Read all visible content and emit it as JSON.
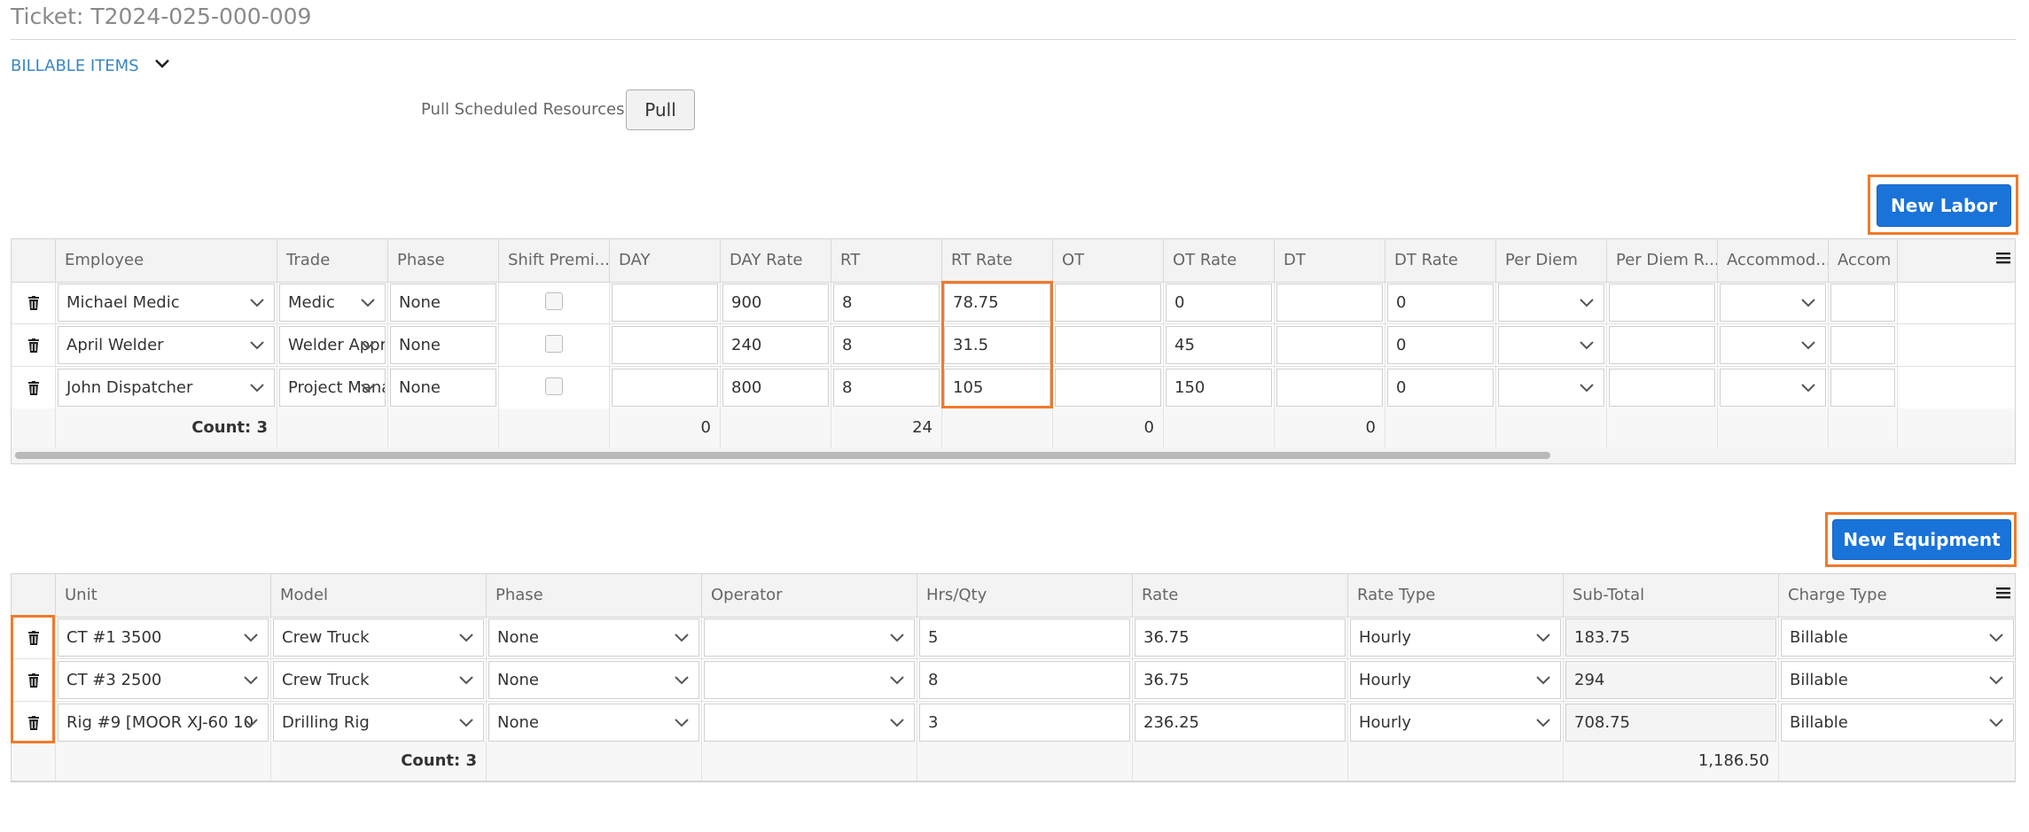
{
  "header": {
    "title": "Ticket: T2024-025-000-009"
  },
  "billable": {
    "section_label": "BILLABLE ITEMS"
  },
  "pull": {
    "label": "Pull Scheduled Resources",
    "button_label": "Pull"
  },
  "labor": {
    "new_button_label": "New Labor",
    "columns": [
      "",
      "Employee",
      "Trade",
      "Phase",
      "Shift Premi...",
      "DAY",
      "DAY Rate",
      "RT",
      "RT Rate",
      "OT",
      "OT Rate",
      "DT",
      "DT Rate",
      "Per Diem",
      "Per Diem R...",
      "Accommod...",
      "Accom"
    ],
    "rows": [
      {
        "employee": "Michael Medic",
        "trade": "Medic",
        "phase": "None",
        "shift_premium": false,
        "day": "",
        "day_rate": "900",
        "rt": "8",
        "rt_rate": "78.75",
        "ot": "",
        "ot_rate": "0",
        "dt": "",
        "dt_rate": "0",
        "per_diem": "",
        "per_diem_rate": "",
        "accommodation": "",
        "accom": ""
      },
      {
        "employee": "April Welder",
        "trade": "Welder Apprentice",
        "phase": "None",
        "shift_premium": false,
        "day": "",
        "day_rate": "240",
        "rt": "8",
        "rt_rate": "31.5",
        "ot": "",
        "ot_rate": "45",
        "dt": "",
        "dt_rate": "0",
        "per_diem": "",
        "per_diem_rate": "",
        "accommodation": "",
        "accom": ""
      },
      {
        "employee": "John Dispatcher",
        "trade": "Project Manager",
        "phase": "None",
        "shift_premium": false,
        "day": "",
        "day_rate": "800",
        "rt": "8",
        "rt_rate": "105",
        "ot": "",
        "ot_rate": "150",
        "dt": "",
        "dt_rate": "0",
        "per_diem": "",
        "per_diem_rate": "",
        "accommodation": "",
        "accom": ""
      }
    ],
    "footer": {
      "count": "Count: 3",
      "day_total": "0",
      "rt_total": "24",
      "ot_total": "0",
      "dt_total": "0"
    }
  },
  "equipment": {
    "new_button_label": "New Equipment",
    "columns": [
      "",
      "Unit",
      "Model",
      "Phase",
      "Operator",
      "Hrs/Qty",
      "Rate",
      "Rate Type",
      "Sub-Total",
      "Charge Type"
    ],
    "rows": [
      {
        "unit": "CT #1 3500",
        "model": "Crew Truck",
        "phase": "None",
        "operator": "",
        "hrs_qty": "5",
        "rate": "36.75",
        "rate_type": "Hourly",
        "subtotal": "183.75",
        "charge_type": "Billable"
      },
      {
        "unit": "CT #3 2500",
        "model": "Crew Truck",
        "phase": "None",
        "operator": "",
        "hrs_qty": "8",
        "rate": "36.75",
        "rate_type": "Hourly",
        "subtotal": "294",
        "charge_type": "Billable"
      },
      {
        "unit": "Rig #9 [MOOR XJ-60 10",
        "model": "Drilling Rig",
        "phase": "None",
        "operator": "",
        "hrs_qty": "3",
        "rate": "236.25",
        "rate_type": "Hourly",
        "subtotal": "708.75",
        "charge_type": "Billable"
      }
    ],
    "footer": {
      "count": "Count: 3",
      "subtotal_total": "1,186.50"
    }
  },
  "icons": {
    "delete": "trash-icon",
    "dropdown": "chevron-down-icon",
    "column_menu": "hamburger-menu-icon",
    "collapse": "chevron-down-icon"
  },
  "colors": {
    "accent": "#1a73d9",
    "highlight": "#f07a2b",
    "link": "#3a86c4"
  }
}
